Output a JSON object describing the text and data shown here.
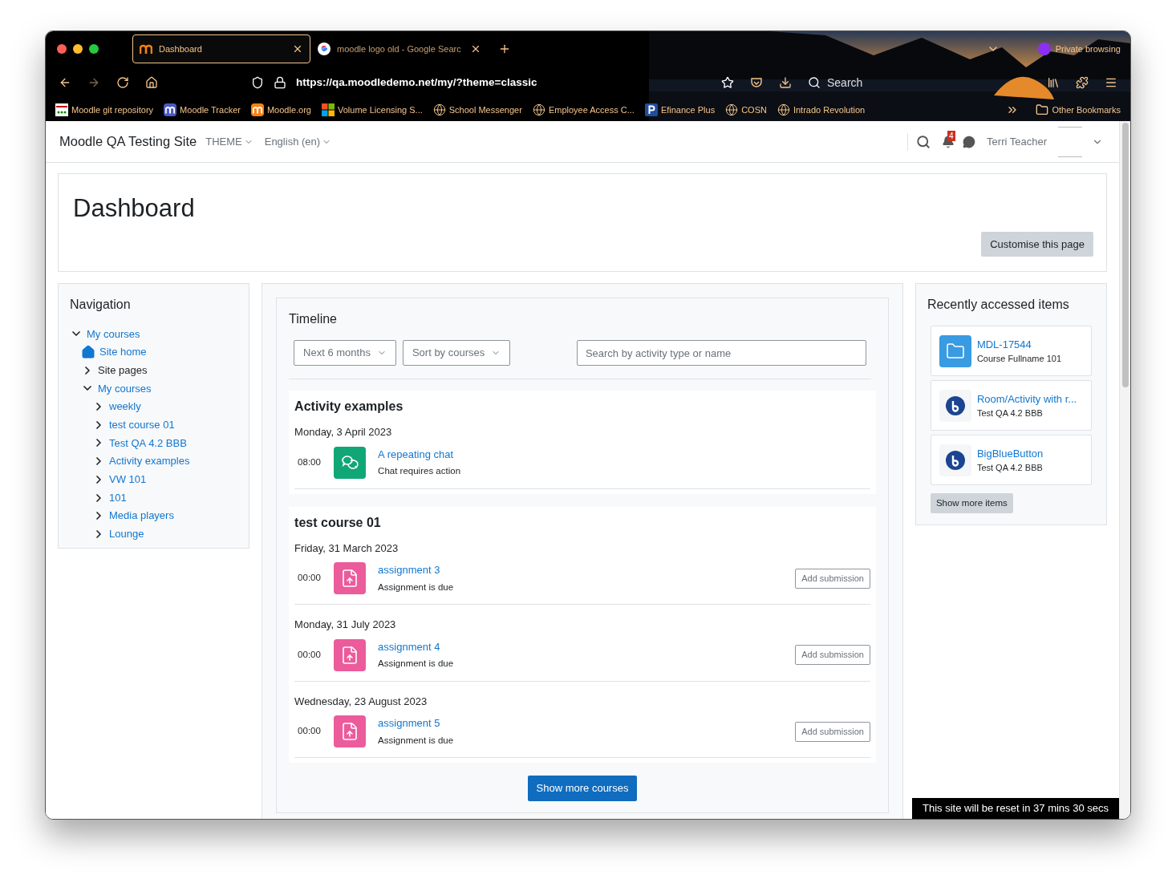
{
  "browser": {
    "tabs": [
      {
        "title": "Dashboard",
        "selected": true,
        "kind": "moodle"
      },
      {
        "title": "moodle logo old - Google Searc",
        "selected": false,
        "kind": "google"
      }
    ],
    "private_label": "Private browsing",
    "url": "https://qa.moodledemo.net/my/?theme=classic",
    "search_label": "Search",
    "bookmarks": [
      {
        "label": "Moodle git repository",
        "kind": "git"
      },
      {
        "label": "Moodle Tracker",
        "kind": "tracker"
      },
      {
        "label": "Moodle.org",
        "kind": "moodle"
      },
      {
        "label": "Volume Licensing S...",
        "kind": "windows"
      },
      {
        "label": "School Messenger",
        "kind": "globe"
      },
      {
        "label": "Employee Access C...",
        "kind": "globe"
      },
      {
        "label": "Efinance Plus",
        "kind": "p"
      },
      {
        "label": "COSN",
        "kind": "globe"
      },
      {
        "label": "Intrado Revolution",
        "kind": "globe"
      }
    ],
    "other_bookmarks": "Other Bookmarks"
  },
  "navbar": {
    "site_name": "Moodle QA Testing Site",
    "menus": [
      "THEME",
      "English (en)"
    ],
    "notification_count": "4",
    "user_name": "Terri Teacher"
  },
  "page": {
    "title": "Dashboard",
    "customise_button": "Customise this page"
  },
  "navigation": {
    "title": "Navigation",
    "items": [
      {
        "label": "My courses",
        "kind": "link",
        "expanded": true,
        "children": [
          {
            "label": "Site home",
            "kind": "home"
          },
          {
            "label": "Site pages",
            "kind": "text",
            "expanded": false
          },
          {
            "label": "My courses",
            "kind": "link",
            "expanded": true,
            "children": [
              {
                "label": "weekly",
                "kind": "link",
                "expanded": false
              },
              {
                "label": "test course 01",
                "kind": "link",
                "expanded": false
              },
              {
                "label": "Test QA 4.2 BBB",
                "kind": "link",
                "expanded": false
              },
              {
                "label": "Activity examples",
                "kind": "link",
                "expanded": false
              },
              {
                "label": "VW 101",
                "kind": "link",
                "expanded": false
              },
              {
                "label": "101",
                "kind": "link",
                "expanded": false
              },
              {
                "label": "Media players",
                "kind": "link",
                "expanded": false
              },
              {
                "label": "Lounge",
                "kind": "link",
                "expanded": false
              }
            ]
          }
        ]
      }
    ]
  },
  "timeline": {
    "title": "Timeline",
    "filter": "Next 6 months",
    "sort": "Sort by courses",
    "search_placeholder": "Search by activity type or name",
    "courses": [
      {
        "name": "Activity examples",
        "days": [
          {
            "date": "Monday, 3 April 2023",
            "events": [
              {
                "time": "08:00",
                "kind": "chat",
                "name": "A repeating chat",
                "status": "Chat requires action"
              }
            ]
          }
        ]
      },
      {
        "name": "test course 01",
        "days": [
          {
            "date": "Friday, 31 March 2023",
            "events": [
              {
                "time": "00:00",
                "kind": "assign",
                "name": "assignment 3",
                "status": "Assignment is due",
                "action": "Add submission"
              }
            ]
          },
          {
            "date": "Monday, 31 July 2023",
            "events": [
              {
                "time": "00:00",
                "kind": "assign",
                "name": "assignment 4",
                "status": "Assignment is due",
                "action": "Add submission"
              }
            ]
          },
          {
            "date": "Wednesday, 23 August 2023",
            "events": [
              {
                "time": "00:00",
                "kind": "assign",
                "name": "assignment 5",
                "status": "Assignment is due",
                "action": "Add submission"
              }
            ]
          }
        ]
      }
    ],
    "show_more": "Show more courses"
  },
  "recent": {
    "title": "Recently accessed items",
    "items": [
      {
        "kind": "folder",
        "name": "MDL-17544",
        "course": "Course Fullname 101"
      },
      {
        "kind": "bbb",
        "name": "Room/Activity with r...",
        "course": "Test QA 4.2 BBB"
      },
      {
        "kind": "bbb",
        "name": "BigBlueButton",
        "course": "Test QA 4.2 BBB"
      }
    ],
    "show_more": "Show more items"
  },
  "reset_notice": "This site will be reset in 37 mins 30 secs"
}
